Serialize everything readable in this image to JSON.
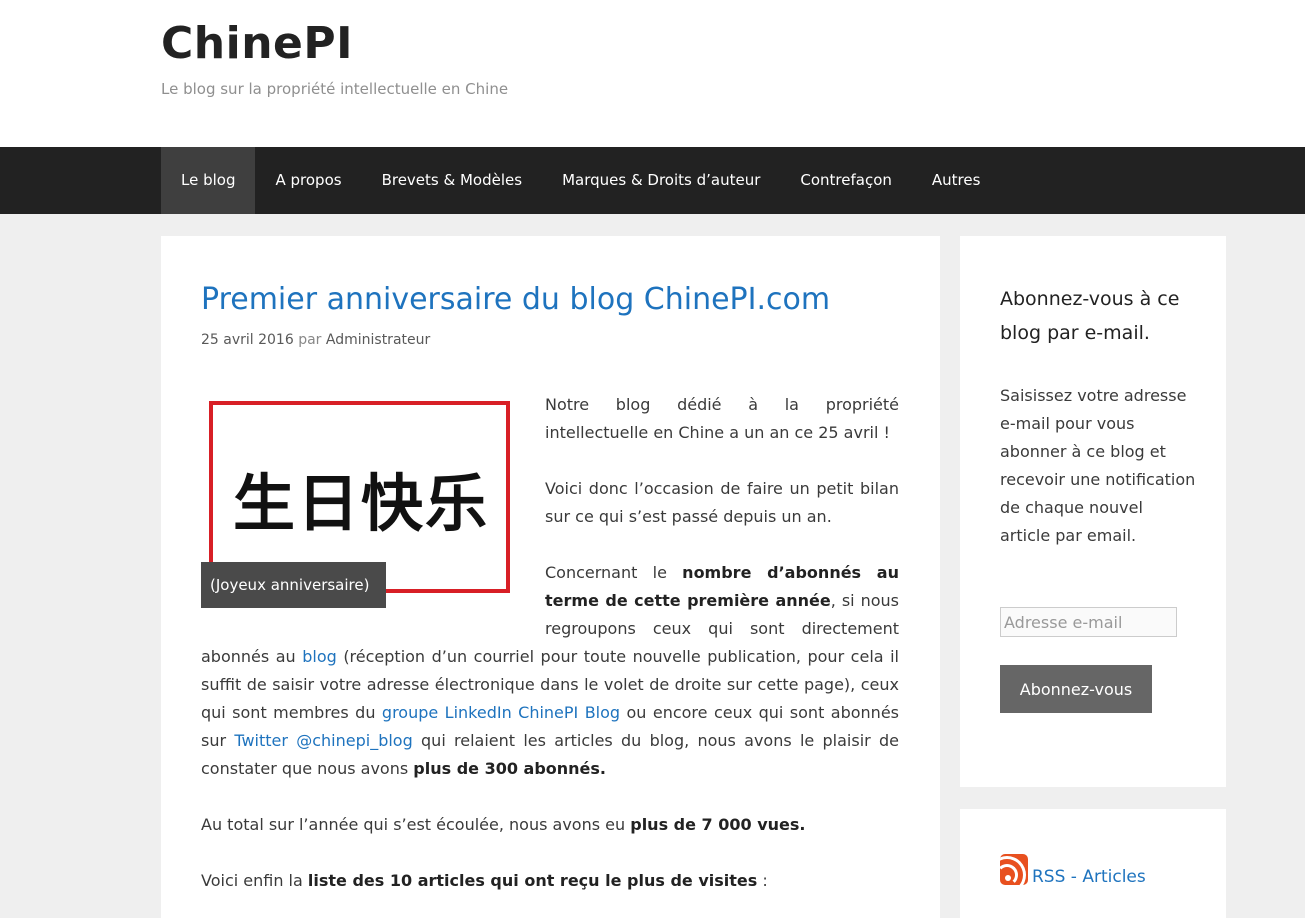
{
  "header": {
    "site_title": "ChinePI",
    "tagline": "Le blog sur la propriété intellectuelle en Chine"
  },
  "nav": {
    "items": [
      {
        "label": "Le blog",
        "active": true
      },
      {
        "label": "A propos"
      },
      {
        "label": "Brevets & Modèles"
      },
      {
        "label": "Marques & Droits d’auteur"
      },
      {
        "label": "Contrefaçon"
      },
      {
        "label": "Autres"
      }
    ]
  },
  "article": {
    "title": "Premier anniversaire du blog ChinePI.com",
    "date": "25 avril 2016",
    "by": "par",
    "author": "Administrateur",
    "figure": {
      "chars": "生日快乐",
      "caption": "(Joyeux anniversaire)"
    },
    "p1": "Notre blog dédié à la propriété intellectuelle en Chine a un an ce 25 avril !",
    "p2": "Voici donc l’occasion de faire un petit bilan sur ce qui s’est passé depuis un an.",
    "p3": {
      "t1": "Concernant le ",
      "b1": "nombre d’abonnés au terme de cette première année",
      "t2": ", si nous regroupons ceux qui sont directement abonnés au ",
      "link1": "blog",
      "t3": " (réception d’un courriel pour toute nouvelle publication, pour cela il suffit de saisir votre adresse électronique dans le volet de droite sur cette page), ceux qui sont membres du ",
      "link2": "groupe LinkedIn ChinePI Blog",
      "t4": " ou encore ceux qui sont abonnés sur  ",
      "link3": "Twitter @chinepi_blog",
      "t5": "   qui relaient les articles du blog, nous avons le plaisir de constater que nous avons ",
      "b2": "plus de 300 abonnés."
    },
    "p4": {
      "t1": "Au total sur l’année qui s’est écoulée, nous avons eu ",
      "b1": "plus de 7 000 vues."
    },
    "p5": {
      "t1": "Voici enfin la ",
      "b1": "liste des 10 articles qui ont reçu le plus de visites",
      "t2": " :"
    }
  },
  "sidebar": {
    "subscribe": {
      "title": "Abonnez-vous à ce blog par e-mail.",
      "text": "Saisissez votre adresse e-mail pour vous abonner à ce blog et recevoir une notification de chaque nouvel article par email.",
      "email_placeholder": "Adresse e-mail",
      "button_label": "Abonnez-vous"
    },
    "rss": {
      "icon": "rss-icon",
      "link_label": "RSS - Articles"
    }
  },
  "colors": {
    "link": "#1e73be",
    "nav_bg": "#222222",
    "nav_active": "#3f3f3f",
    "figure_border": "#d81f26",
    "button_bg": "#666666",
    "rss_orange": "#e8501f"
  }
}
